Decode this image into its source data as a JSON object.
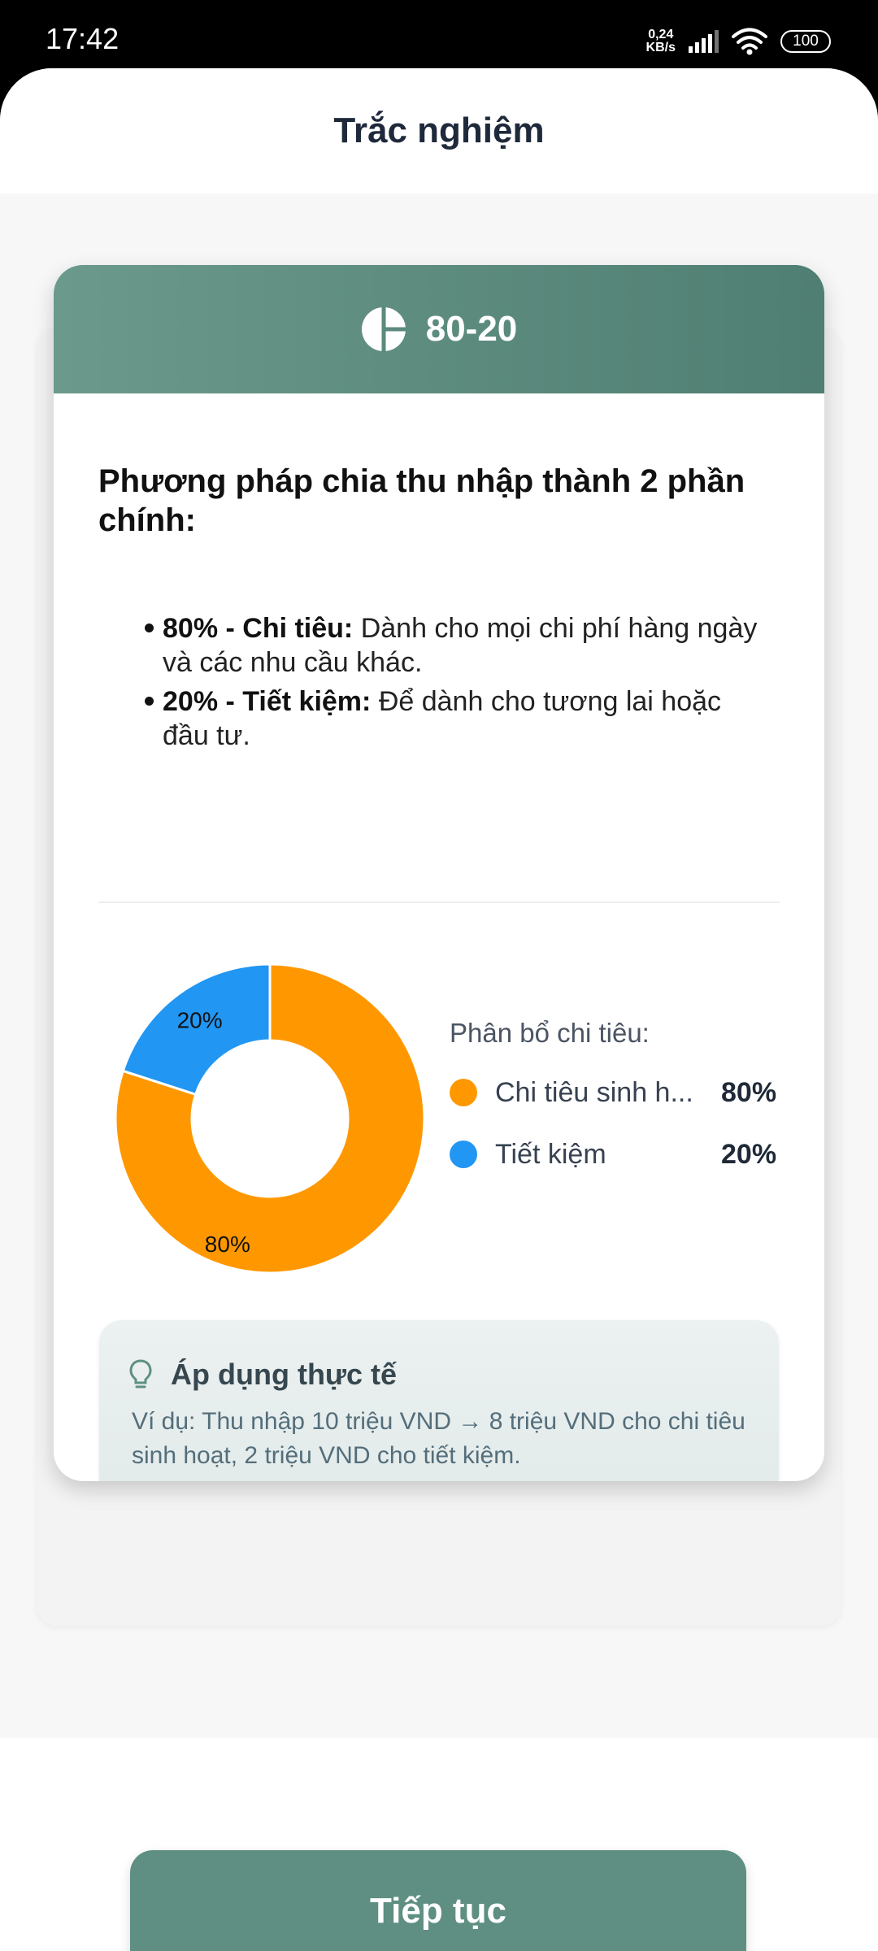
{
  "status_bar": {
    "time": "17:42",
    "net_speed_value": "0,24",
    "net_speed_unit": "KB/s",
    "battery": "100"
  },
  "header": {
    "title": "Trắc nghiệm"
  },
  "card": {
    "title": "80-20",
    "icon": "pie-chart-icon",
    "heading": "Phương pháp chia thu nhập thành 2 phần chính:",
    "bullets": [
      {
        "bold": "80% - Chi tiêu:",
        "text": " Dành cho mọi chi phí hàng ngày và các nhu cầu khác."
      },
      {
        "bold": "20% - Tiết kiệm:",
        "text": " Để dành cho tương lai hoặc đầu tư."
      }
    ]
  },
  "chart_data": {
    "type": "pie",
    "variant": "donut",
    "title": "",
    "labels": [
      "Chi tiêu sinh h...",
      "Tiết kiệm"
    ],
    "values": [
      80,
      20
    ],
    "value_labels": [
      "80%",
      "20%"
    ],
    "colors": [
      "#ff9800",
      "#2196f3"
    ],
    "legend_title": "Phân bổ chi tiêu:",
    "legend_position": "right"
  },
  "tip": {
    "icon": "lightbulb-icon",
    "title": "Áp dụng thực tế",
    "text": "Ví dụ: Thu nhập 10 triệu VND → 8 triệu VND cho chi tiêu sinh hoạt, 2 triệu VND cho tiết kiệm."
  },
  "footer": {
    "continue_label": "Tiếp tục"
  },
  "colors": {
    "accent": "#5e8f82",
    "header_start": "#6b9a8c",
    "header_end": "#4f7e72"
  }
}
